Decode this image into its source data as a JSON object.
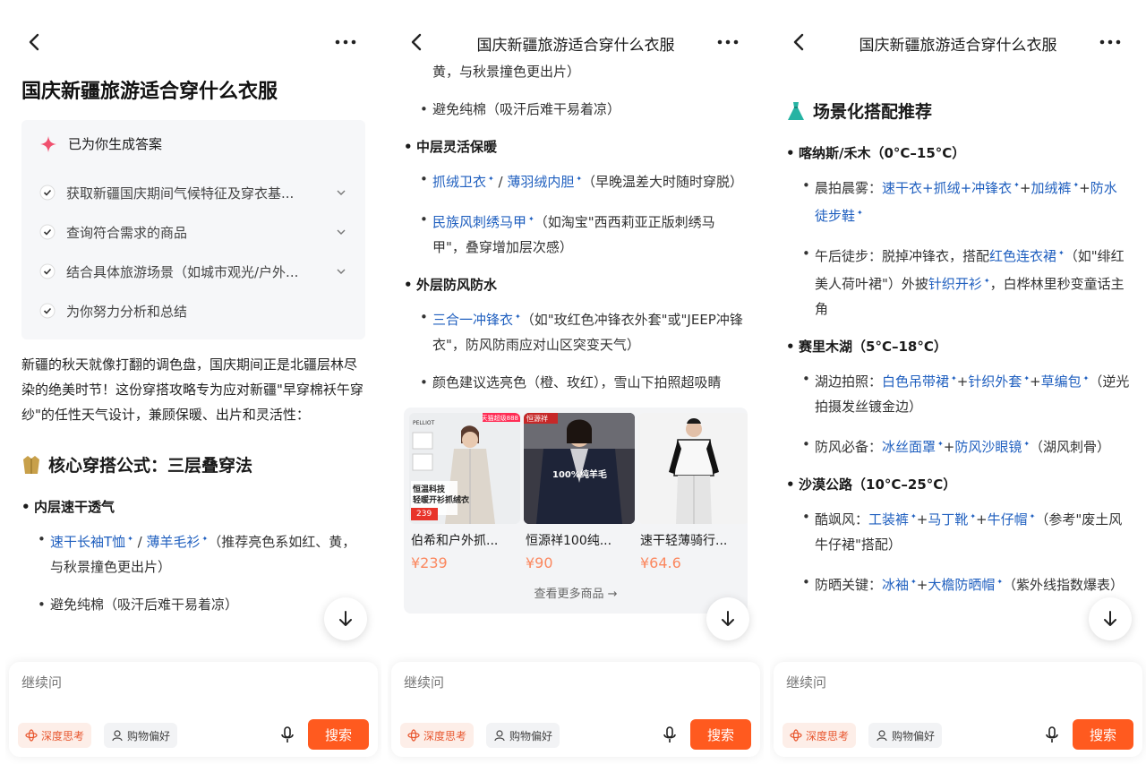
{
  "colors": {
    "accent": "#ff5a1f",
    "link": "#1f5fbf",
    "card_bg": "#f6f7f9"
  },
  "common": {
    "title": "国庆新疆旅游适合穿什么衣服",
    "input_placeholder": "继续问",
    "deep_think": "深度思考",
    "shopping_pref": "购物偏好",
    "search": "搜索"
  },
  "p1": {
    "page_title": "国庆新疆旅游适合穿什么衣服",
    "answer_head": "已为你生成答案",
    "steps": [
      "获取新疆国庆期间气候特征及穿衣基...",
      "查询符合需求的商品",
      "结合具体旅游场景（如城市观光/户外...",
      "为你努力分析和总结"
    ],
    "intro": "新疆的秋天就像打翻的调色盘，国庆期间正是北疆层林尽染的绝美时节！这份穿搭攻略专为应对新疆\"早穿棉袄午穿纱\"的任性天气设计，兼顾保暖、出片和灵活性：",
    "section_title": "核心穿搭公式：三层叠穿法",
    "inner_layer": "内层速干透气",
    "i1_link1": "速干长袖T恤",
    "i1_sep": " / ",
    "i1_link2": "薄羊毛衫",
    "i1_tail": "（推荐亮色系如红、黄，与秋景撞色更出片）",
    "i2": "避免纯棉（吸汗后难干易着凉）"
  },
  "p2": {
    "top_cont": "黄，与秋景撞色更出片）",
    "s1": "避免纯棉（吸汗后难干易着凉）",
    "mid_layer": "中层灵活保暖",
    "m1_link1": "抓绒卫衣",
    "m1_sep": " / ",
    "m1_link2": "薄羽绒内胆",
    "m1_tail": "（早晚温差大时随时穿脱）",
    "m2_link": "民族风刺绣马甲",
    "m2_tail": "（如淘宝\"西西莉亚正版刺绣马甲\"，叠穿增加层次感）",
    "outer_layer": "外层防风防水",
    "o1_link": "三合一冲锋衣",
    "o1_tail": "（如\"玫红色冲锋衣外套\"或\"JEEP冲锋衣\"，防风防雨应对山区突变天气）",
    "o2": "颜色建议选亮色（橙、玫红），雪山下拍照超吸睛",
    "products": [
      {
        "name": "伯希和户外抓...",
        "price": "¥239",
        "badge": "天猫超级888",
        "img_text1": "恒温科技",
        "img_text2": "轻暖开衫抓绒衣",
        "img_price": "239",
        "brand": "PELLIOT"
      },
      {
        "name": "恒源祥100纯...",
        "price": "¥90",
        "badge": "恒源祥",
        "img_text1": "100%纯羊毛",
        "img_text2": "",
        "img_price": "",
        "brand": ""
      },
      {
        "name": "速干轻薄骑行...",
        "price": "¥64.6",
        "badge": "",
        "img_text1": "",
        "img_text2": "",
        "img_price": "",
        "brand": ""
      }
    ],
    "see_more": "查看更多商品 →"
  },
  "p3": {
    "section_title": "场景化搭配推荐",
    "place1": "喀纳斯/禾木（0°C–15°C）",
    "a1_prefix": "晨拍晨雾：",
    "a1_l1": "速干衣+抓绒+冲锋衣",
    "a1_plus1": "+",
    "a1_l2": "加绒裤",
    "a1_plus2": "+",
    "a1_l3": "防水徒步鞋",
    "a2_prefix": "午后徒步：脱掉冲锋衣，搭配",
    "a2_l1": "红色连衣裙",
    "a2_mid": "（如\"绯红美人荷叶裙\"）外披",
    "a2_l2": "针织开衫",
    "a2_tail": "，白桦林里秒变童话主角",
    "place2": "赛里木湖（5°C–18°C）",
    "b1_prefix": "湖边拍照：",
    "b1_l1": "白色吊带裙",
    "b1_plus1": "+",
    "b1_l2": "针织外套",
    "b1_plus2": "+",
    "b1_l3": "草编包",
    "b1_tail": "（逆光拍摄发丝镀金边）",
    "b2_prefix": "防风必备：",
    "b2_l1": "冰丝面罩",
    "b2_plus": "+",
    "b2_l2": "防风沙眼镜",
    "b2_tail": "（湖风刺骨）",
    "place3": "沙漠公路（10°C–25°C）",
    "c1_prefix": "酷飒风：",
    "c1_l1": "工装裤",
    "c1_plus1": "+",
    "c1_l2": "马丁靴",
    "c1_plus2": "+",
    "c1_l3": "牛仔帽",
    "c1_tail": "（参考\"废土风牛仔裙\"搭配）",
    "c2_prefix": "防晒关键：",
    "c2_l1": "冰袖",
    "c2_plus": "+",
    "c2_l2": "大檐防晒帽",
    "c2_tail": "（紫外线指数爆表）"
  }
}
